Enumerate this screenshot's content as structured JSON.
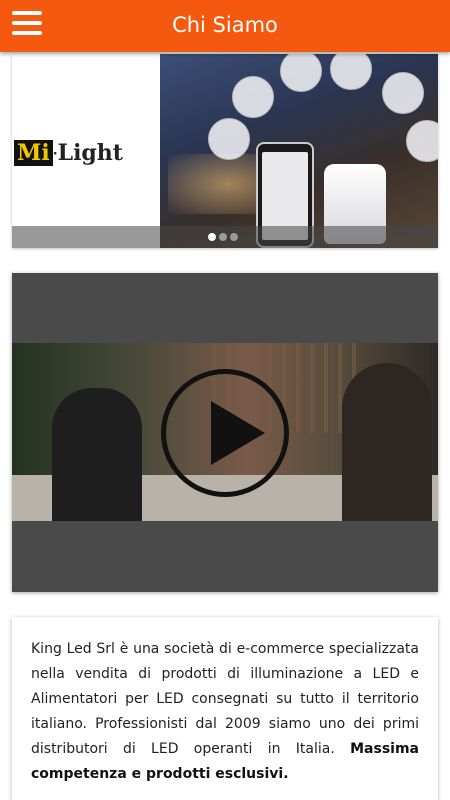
{
  "header": {
    "title": "Chi Siamo",
    "menu_icon": "hamburger-menu-icon",
    "background": "#f4590f"
  },
  "slider": {
    "logo_prefix": "Mi",
    "logo_dot": "·",
    "logo_suffix": "Light",
    "slide_count": 3,
    "active_slide": 1
  },
  "video": {
    "play_icon": "play-icon"
  },
  "about": {
    "text": "King Led Srl è una società di e-commerce specializzata nella vendita di prodotti di illuminazione a LED e Alimentatori per LED consegnati su tutto il territorio italiano. Professionisti dal 2009 siamo uno dei primi distributori di LED operanti in Italia. ",
    "highlight": "Massima competenza e prodotti esclusivi."
  }
}
